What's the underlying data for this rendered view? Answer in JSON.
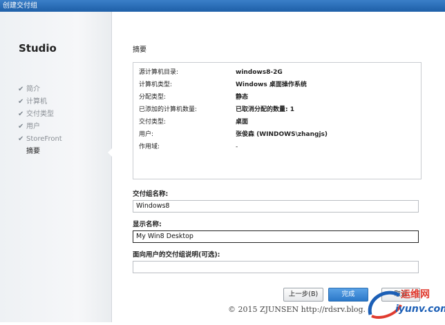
{
  "window": {
    "title": "创建交付组"
  },
  "sidebar": {
    "brand": "Studio",
    "steps": [
      {
        "label": "简介",
        "done": true
      },
      {
        "label": "计算机",
        "done": true
      },
      {
        "label": "交付类型",
        "done": true
      },
      {
        "label": "用户",
        "done": true
      },
      {
        "label": "StoreFront",
        "done": true
      },
      {
        "label": "摘要",
        "done": false,
        "active": true
      }
    ]
  },
  "main": {
    "section_title": "摘要",
    "summary": [
      {
        "key": "源计算机目录:",
        "value": "windows8-2G"
      },
      {
        "key": "计算机类型:",
        "value": "Windows 桌面操作系统"
      },
      {
        "key": "分配类型:",
        "value": "静态"
      },
      {
        "key": "已添加的计算机数量:",
        "value": "已取消分配的数量: 1"
      },
      {
        "key": "交付类型:",
        "value": "桌面"
      },
      {
        "key": "用户:",
        "value": "张俊森 (WINDOWS\\zhangjs)"
      },
      {
        "key": "作用域:",
        "value": "-"
      }
    ],
    "delivery_group_name": {
      "label": "交付组名称:",
      "value": "Windows8"
    },
    "display_name": {
      "label": "显示名称:",
      "value": "My Win8 Desktop"
    },
    "user_description": {
      "label": "面向用户的交付组说明(可选):",
      "value": ""
    }
  },
  "buttons": {
    "back": "上一步(B)",
    "finish": "完成",
    "cancel": "取消"
  },
  "watermark": {
    "text": "© 2015 ZJUNSEN http://rdsrv.blog."
  },
  "logo": {
    "top": "运维网",
    "bottom": "iyunv.com"
  },
  "icons": {
    "check": "checkmark-icon"
  }
}
